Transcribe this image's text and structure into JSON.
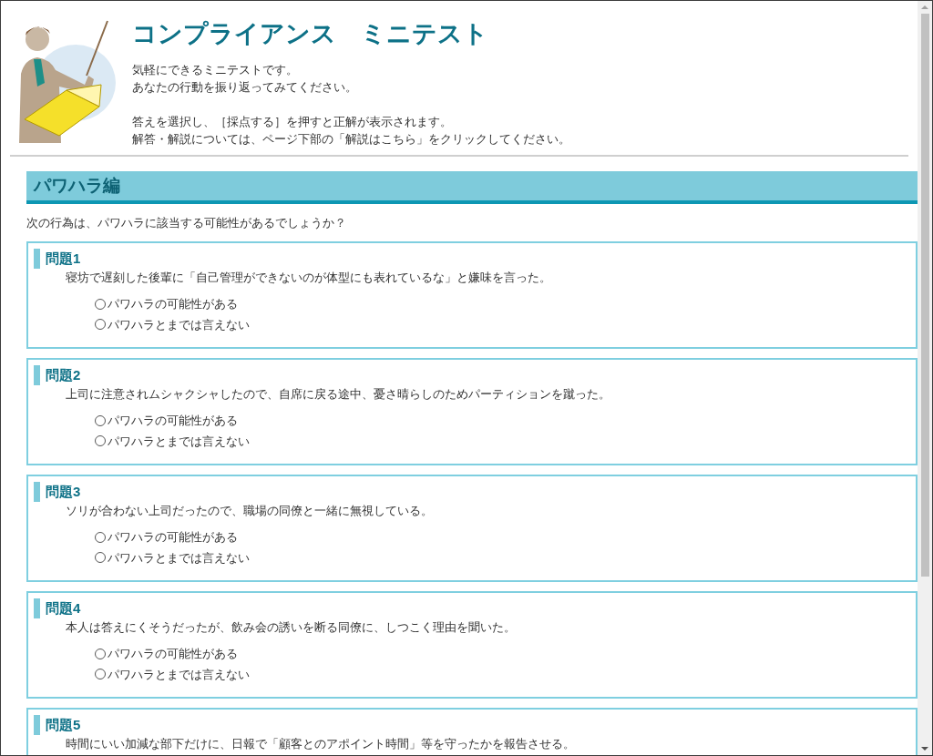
{
  "header": {
    "title": "コンプライアンス　ミニテスト",
    "intro": [
      "気軽にできるミニテストです。",
      "あなたの行動を振り返ってみてください。"
    ],
    "instructions": [
      "答えを選択し、［採点する］を押すと正解が表示されます。",
      "解答・解説については、ページ下部の「解説はこちら」をクリックしてください。"
    ]
  },
  "section": {
    "title": "パワハラ編",
    "lead": "次の行為は、パワハラに該当する可能性があるでしょうか？"
  },
  "questions": [
    {
      "title": "問題1",
      "text": "寝坊で遅刻した後輩に「自己管理ができないのが体型にも表れているな」と嫌味を言った。",
      "options": [
        {
          "label": "パワハラの可能性がある",
          "selected": false
        },
        {
          "label": "パワハラとまでは言えない",
          "selected": false
        }
      ]
    },
    {
      "title": "問題2",
      "text": "上司に注意されムシャクシャしたので、自席に戻る途中、憂さ晴らしのためパーティションを蹴った。",
      "options": [
        {
          "label": "パワハラの可能性がある",
          "selected": false
        },
        {
          "label": "パワハラとまでは言えない",
          "selected": false
        }
      ]
    },
    {
      "title": "問題3",
      "text": "ソリが合わない上司だったので、職場の同僚と一緒に無視している。",
      "options": [
        {
          "label": "パワハラの可能性がある",
          "selected": false
        },
        {
          "label": "パワハラとまでは言えない",
          "selected": false
        }
      ]
    },
    {
      "title": "問題4",
      "text": "本人は答えにくそうだったが、飲み会の誘いを断る同僚に、しつこく理由を聞いた。",
      "options": [
        {
          "label": "パワハラの可能性がある",
          "selected": false
        },
        {
          "label": "パワハラとまでは言えない",
          "selected": false
        }
      ]
    },
    {
      "title": "問題5",
      "text": "時間にいい加減な部下だけに、日報で「顧客とのアポイント時間」等を守ったかを報告させる。"
    }
  ]
}
